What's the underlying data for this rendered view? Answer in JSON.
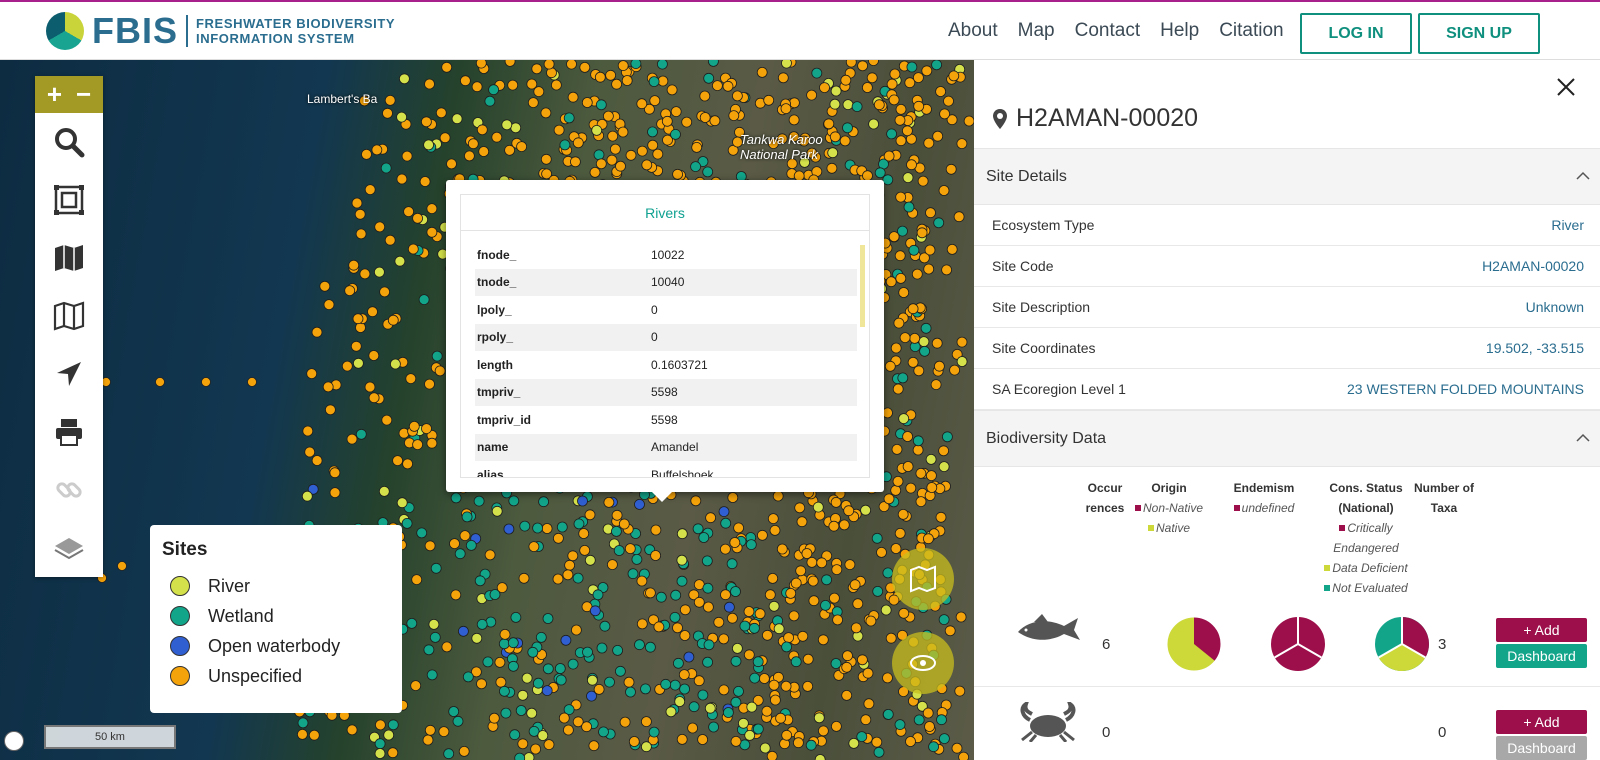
{
  "header": {
    "logo_abbr": "FBIS",
    "logo_line1": "FRESHWATER BIODIVERSITY",
    "logo_line2": "INFORMATION SYSTEM",
    "nav": [
      "About",
      "Map",
      "Contact",
      "Help",
      "Citation"
    ],
    "login_label": "LOG IN",
    "signup_label": "SIGN UP"
  },
  "map": {
    "place_labels": [
      "Lambert's Ba",
      "Tankwa Karoo National Park"
    ],
    "zoom_in": "+",
    "zoom_out": "−",
    "scale_label": "50 km",
    "legend": {
      "title": "Sites",
      "items": [
        {
          "label": "River",
          "color": "#d4e14a"
        },
        {
          "label": "Wetland",
          "color": "#12a58a"
        },
        {
          "label": "Open waterbody",
          "color": "#2f5fd0"
        },
        {
          "label": "Unspecified",
          "color": "#f5a30a"
        }
      ]
    }
  },
  "popup": {
    "title": "Rivers",
    "rows": [
      {
        "k": "fnode_",
        "v": "10022"
      },
      {
        "k": "tnode_",
        "v": "10040"
      },
      {
        "k": "lpoly_",
        "v": "0"
      },
      {
        "k": "rpoly_",
        "v": "0"
      },
      {
        "k": "length",
        "v": "0.1603721"
      },
      {
        "k": "tmpriv_",
        "v": "5598"
      },
      {
        "k": "tmpriv_id",
        "v": "5598"
      },
      {
        "k": "name",
        "v": "Amandel"
      },
      {
        "k": "alias",
        "v": "Buffelshoek"
      }
    ]
  },
  "panel": {
    "site_code_title": "H2AMAN-00020",
    "site_details_label": "Site Details",
    "details": [
      {
        "k": "Ecosystem Type",
        "v": "River"
      },
      {
        "k": "Site Code",
        "v": "H2AMAN-00020"
      },
      {
        "k": "Site Description",
        "v": "Unknown"
      },
      {
        "k": "Site Coordinates",
        "v": "19.502, -33.515"
      },
      {
        "k": "SA Ecoregion Level 1",
        "v": "23 WESTERN FOLDED MOUNTAINS"
      }
    ],
    "biodiversity_label": "Biodiversity Data",
    "columns": {
      "occurrences": "Occur rences",
      "origin": "Origin",
      "endemism": "Endemism",
      "cons_status": "Cons. Status (National)",
      "num_taxa": "Number of Taxa"
    },
    "origin_legend": [
      "Non-Native",
      "Native"
    ],
    "endemism_legend": [
      "undefined"
    ],
    "cons_legend": [
      "Critically Endangered",
      "Data Deficient",
      "Not Evaluated"
    ],
    "rows": [
      {
        "group": "fish",
        "occurrences": "6",
        "taxa": "3",
        "add_label": "+ Add",
        "dashboard_label": "Dashboard"
      },
      {
        "group": "invertebrates",
        "occurrences": "0",
        "taxa": "0",
        "add_label": "+ Add",
        "dashboard_label": "Dashboard"
      }
    ],
    "colors": {
      "maroon": "#9c0f4a",
      "lime": "#ccd938",
      "teal": "#12a58a",
      "grey": "#a8a8a8"
    }
  }
}
